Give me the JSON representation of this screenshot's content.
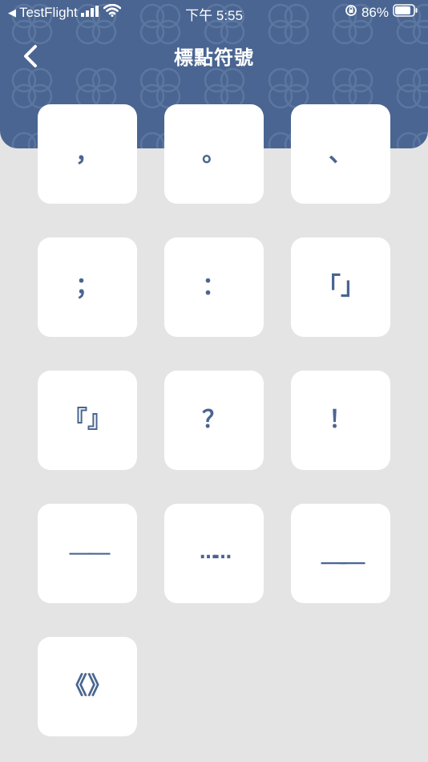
{
  "status_bar": {
    "back_app": "TestFlight",
    "time": "下午 5:55",
    "battery": "86%"
  },
  "header": {
    "title": "標點符號"
  },
  "colors": {
    "header_bg": "#4a6591",
    "page_bg": "#e4e4e4",
    "key_bg": "#ffffff",
    "key_text": "#4a6591"
  },
  "keys": [
    {
      "symbol": "，",
      "name": "comma"
    },
    {
      "symbol": "。",
      "name": "period"
    },
    {
      "symbol": "、",
      "name": "enumeration-comma"
    },
    {
      "symbol": "；",
      "name": "semicolon"
    },
    {
      "symbol": "：",
      "name": "colon"
    },
    {
      "symbol": "「」",
      "name": "single-quotes"
    },
    {
      "symbol": "『』",
      "name": "double-quotes"
    },
    {
      "symbol": "？",
      "name": "question-mark"
    },
    {
      "symbol": "！",
      "name": "exclamation-mark"
    },
    {
      "symbol": "——",
      "name": "dash"
    },
    {
      "symbol": "……",
      "name": "ellipsis"
    },
    {
      "symbol": "＿＿",
      "name": "underline"
    },
    {
      "symbol": "《》",
      "name": "book-title-marks"
    }
  ]
}
